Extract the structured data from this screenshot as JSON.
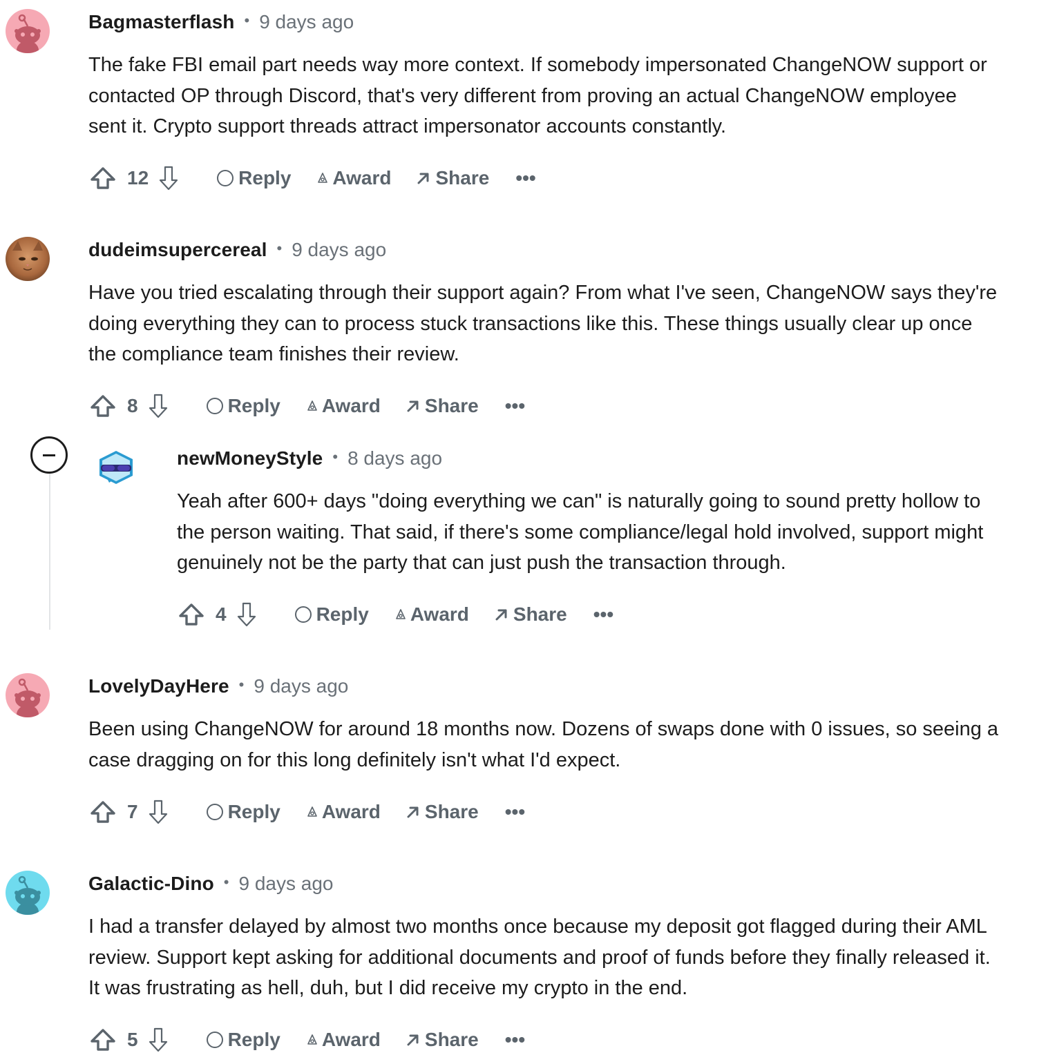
{
  "comments": [
    {
      "author": "Bagmasterflash",
      "separator": "•",
      "time": "9 days ago",
      "paragraph_lines": [
        "The fake FBI email part needs way more context. If somebody impersonated ChangeNOW support or",
        "contacted OP through Discord, that's very different from proving an actual ChangeNOW employee",
        "sent it. Crypto support threads attract impersonator accounts constantly."
      ],
      "score": "12",
      "avatar": "snoo-pink"
    },
    {
      "author": "dudeimsupercereal",
      "separator": "•",
      "time": "9 days ago",
      "paragraph_lines": [
        "Have you tried escalating through their support again? From what I've seen, ChangeNOW says they're",
        "doing everything they can to process stuck transactions like this. These things usually clear up once",
        "the compliance team finishes their review."
      ],
      "score": "8",
      "avatar": "cat-photo"
    },
    {
      "author": "newMoneyStyle",
      "separator": "•",
      "time": "8 days ago",
      "paragraph_lines": [
        "Yeah after 600+ days \"doing everything we can\" is naturally going to sound pretty hollow to",
        "the person waiting. That said, if there's some compliance/legal hold involved, support might",
        "genuinely not be the party that can just push the transaction through."
      ],
      "score": "4",
      "avatar": "snoo-sunglasses"
    },
    {
      "author": "LovelyDayHere",
      "separator": "•",
      "time": "9 days ago",
      "paragraph_lines": [
        "Been using ChangeNOW for around 18 months now. Dozens of swaps done with 0 issues, so seeing a",
        "case dragging on for this long definitely isn't what I'd expect."
      ],
      "score": "7",
      "avatar": "snoo-pink"
    },
    {
      "author": "Galactic-Dino",
      "separator": "•",
      "time": "9 days ago",
      "paragraph_lines": [
        "I had a transfer delayed by almost two months once because my deposit got flagged during their AML",
        "review. Support kept asking for additional documents and proof of funds before they finally released it.",
        "It was frustrating as hell, duh, but I did receive my crypto in the end."
      ],
      "score": "5",
      "avatar": "snoo-cyan"
    }
  ],
  "actions": {
    "reply_label": "Reply",
    "award_label": "Award",
    "share_label": "Share",
    "more_label": "•••"
  },
  "colors": {
    "text": "#1c1c1c",
    "meta": "#6a7178",
    "action": "#5b646c",
    "thread_line": "#e2e4e6",
    "snoo_pink_bg": "#f6a9b4",
    "snoo_cyan_bg": "#6fdbee"
  },
  "icons": {
    "upvote": "upvote-arrow-icon",
    "downvote": "downvote-arrow-icon",
    "reply": "reply-bubble-icon",
    "award": "award-icon",
    "share": "share-arrow-icon",
    "more": "more-dots-icon",
    "collapse": "collapse-minus-icon"
  }
}
